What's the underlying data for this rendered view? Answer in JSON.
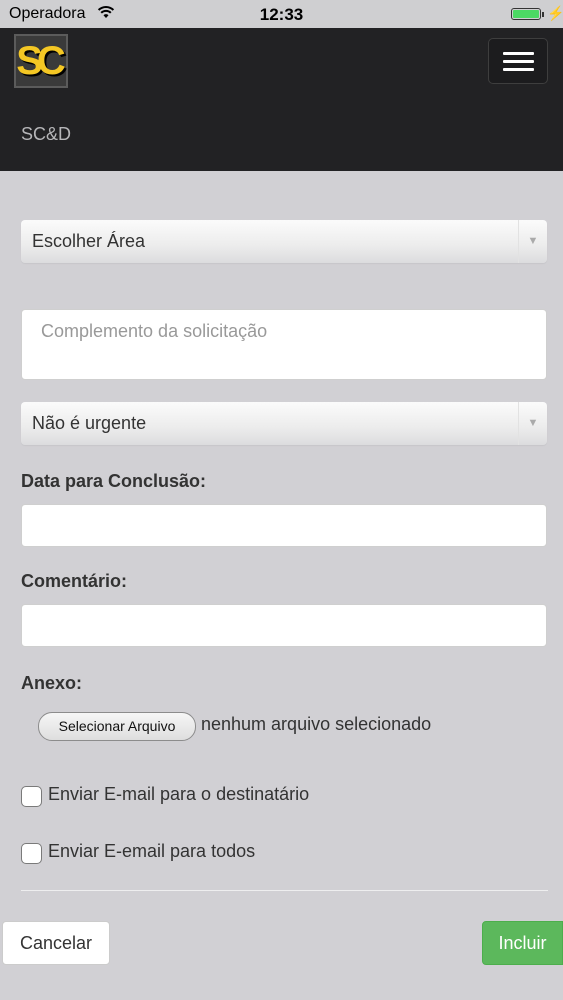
{
  "status_bar": {
    "carrier": "Operadora",
    "time": "12:33"
  },
  "navbar": {
    "logo_text": "SC",
    "brand": "SC&D"
  },
  "form": {
    "area_select": "Escolher Área",
    "complement_placeholder": "Complemento da solicitação",
    "urgency_select": "Não é urgente",
    "date_label": "Data para Conclusão:",
    "comment_label": "Comentário:",
    "attachment_label": "Anexo:",
    "file_button": "Selecionar Arquivo",
    "file_status": "nenhum arquivo selecionado",
    "email_recipient_label": "Enviar E-mail para o destinatário",
    "email_all_label": "Enviar E-email para todos"
  },
  "actions": {
    "cancel": "Cancelar",
    "submit": "Incluir"
  },
  "colors": {
    "navbar": "#222224",
    "background": "#d1d0d4",
    "submit": "#5cb85c",
    "logo_yellow": "#f4c724"
  }
}
